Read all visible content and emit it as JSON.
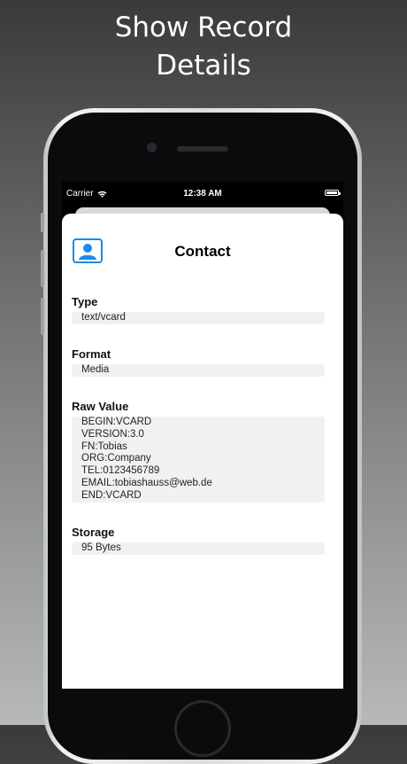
{
  "headline": {
    "line1": "Show Record",
    "line2": "Details"
  },
  "status_bar": {
    "carrier": "Carrier",
    "time": "12:38 AM"
  },
  "record": {
    "title": "Contact",
    "fields": [
      {
        "label": "Type",
        "value": "text/vcard"
      },
      {
        "label": "Format",
        "value": "Media"
      },
      {
        "label": "Raw Value",
        "value": "BEGIN:VCARD\nVERSION:3.0\nFN:Tobias\nORG:Company\nTEL:0123456789\nEMAIL:tobiashauss@web.de\nEND:VCARD"
      },
      {
        "label": "Storage",
        "value": "95 Bytes"
      }
    ]
  },
  "icons": {
    "contact": "contact-card-icon",
    "wifi": "wifi-icon",
    "battery": "battery-icon"
  },
  "colors": {
    "accent": "#1a8be8",
    "field_background": "#f1f1f3"
  }
}
